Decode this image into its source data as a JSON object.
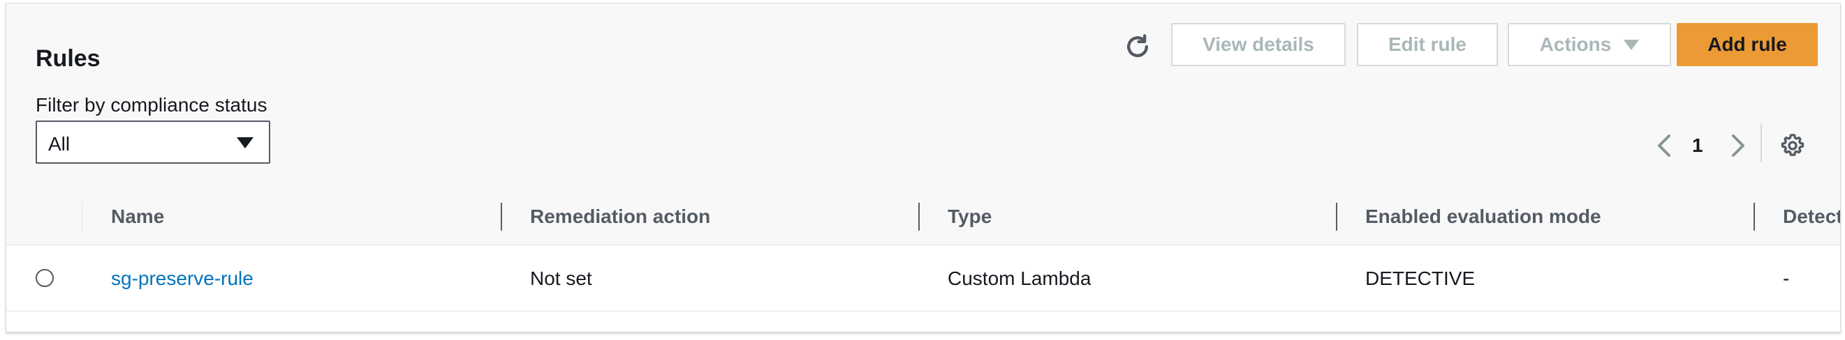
{
  "section": {
    "title": "Rules",
    "filter_label": "Filter by compliance status",
    "filter_value": "All"
  },
  "toolbar": {
    "view_details": "View details",
    "edit_rule": "Edit rule",
    "actions": "Actions",
    "add_rule": "Add rule"
  },
  "pagination": {
    "current_page": "1"
  },
  "table": {
    "columns": [
      "Name",
      "Remediation action",
      "Type",
      "Enabled evaluation mode",
      "Detect"
    ],
    "rows": [
      {
        "name": "sg-preserve-rule",
        "remediation": "Not set",
        "type": "Custom Lambda",
        "mode": "DETECTIVE",
        "detect": "-"
      }
    ]
  },
  "colors": {
    "primary_button": "#ec9a35",
    "link": "#0073bb",
    "disabled_text": "#aab7b8"
  }
}
